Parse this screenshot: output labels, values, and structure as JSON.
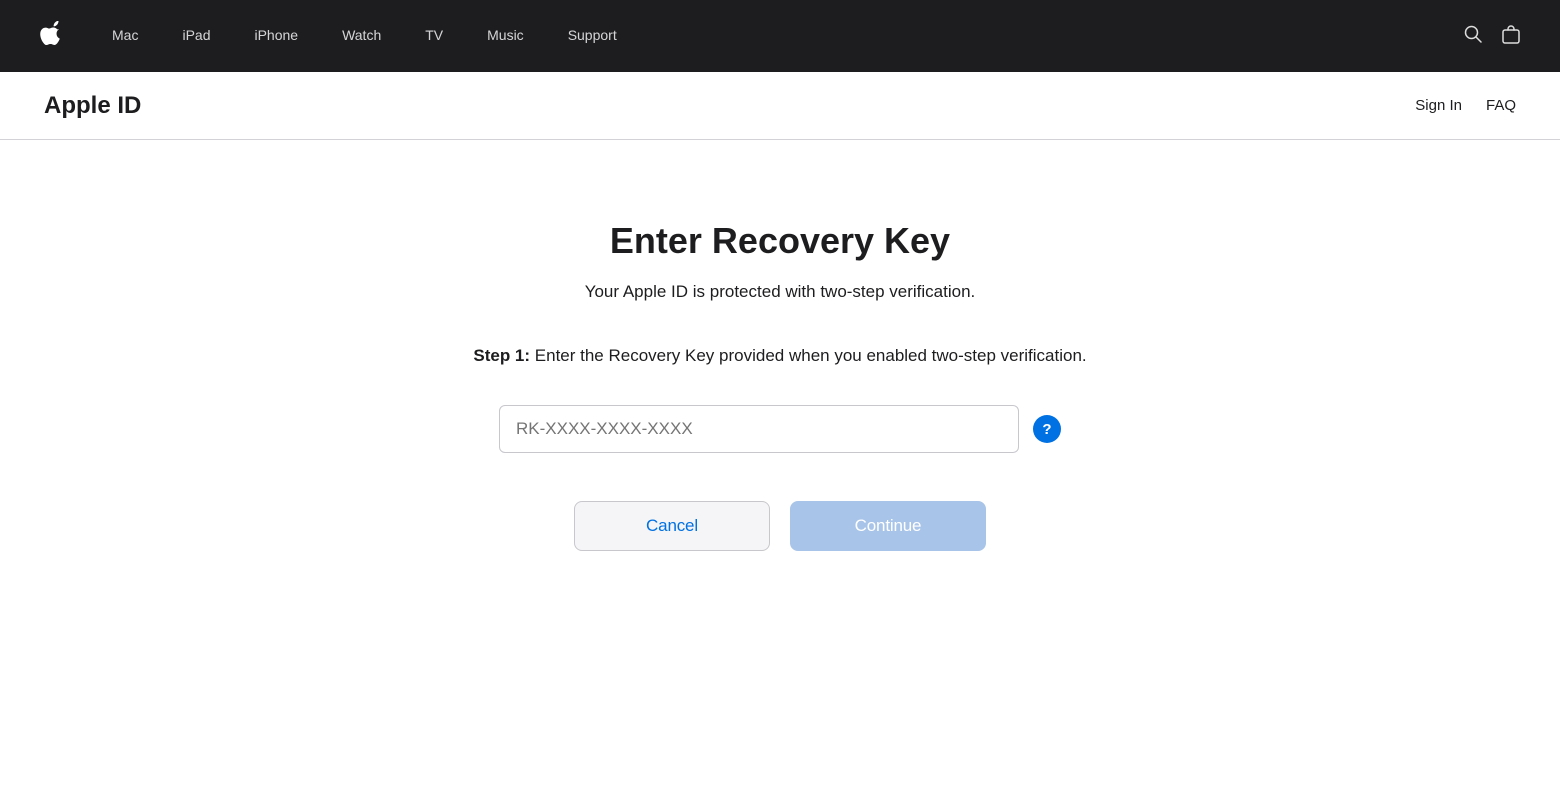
{
  "nav": {
    "apple_logo": "🍎",
    "links": [
      {
        "label": "Mac",
        "id": "mac"
      },
      {
        "label": "iPad",
        "id": "ipad"
      },
      {
        "label": "iPhone",
        "id": "iphone"
      },
      {
        "label": "Watch",
        "id": "watch"
      },
      {
        "label": "TV",
        "id": "tv"
      },
      {
        "label": "Music",
        "id": "music"
      },
      {
        "label": "Support",
        "id": "support"
      }
    ],
    "search_icon": "🔍",
    "bag_icon": "🛍"
  },
  "secondary_header": {
    "title": "Apple ID",
    "sign_in_label": "Sign In",
    "faq_label": "FAQ"
  },
  "main": {
    "page_title": "Enter Recovery Key",
    "subtitle": "Your Apple ID is protected with two-step verification.",
    "step_label": "Step 1:",
    "step_description": " Enter the Recovery Key provided when you enabled two-step verification.",
    "input_placeholder": "RK-XXXX-XXXX-XXXX",
    "help_icon_label": "?",
    "cancel_label": "Cancel",
    "continue_label": "Continue"
  }
}
